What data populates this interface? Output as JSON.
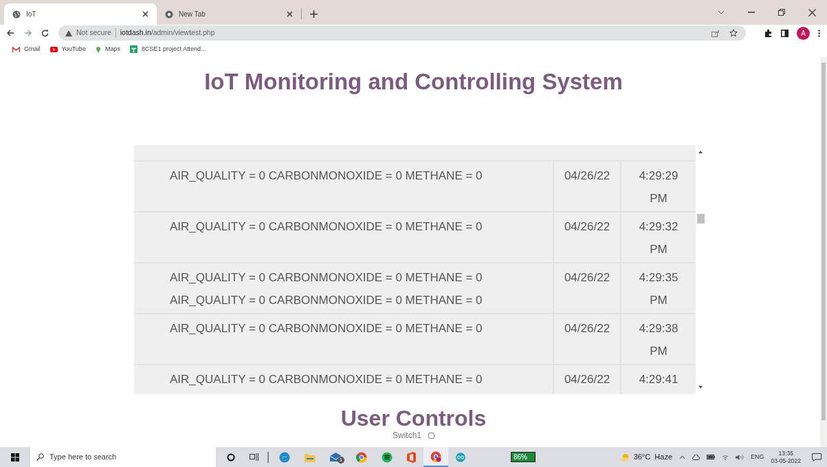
{
  "browser": {
    "tabs": [
      {
        "title": "IoT",
        "selected": true
      },
      {
        "title": "New Tab",
        "selected": false
      }
    ],
    "address": {
      "warning": "Not secure",
      "url_host": "iotdash.in",
      "url_path": "/admin/viewtest.php"
    },
    "profile_initial": "A",
    "bookmarks": [
      {
        "label": "Gmail",
        "kind": "gmail"
      },
      {
        "label": "YouTube",
        "kind": "youtube"
      },
      {
        "label": "Maps",
        "kind": "maps"
      },
      {
        "label": "8CSE1 project Attend...",
        "kind": "sheets"
      }
    ]
  },
  "page": {
    "title": "IoT Monitoring and Controlling System",
    "table": {
      "rows": [
        {
          "reading": "AIR_QUALITY = 0 CARBONMONOXIDE = 0 METHANE = 0",
          "date": "04/26/22",
          "time": "4:29:29 PM"
        },
        {
          "reading": "AIR_QUALITY = 0 CARBONMONOXIDE = 0 METHANE = 0",
          "date": "04/26/22",
          "time": "4:29:32 PM"
        },
        {
          "reading": "AIR_QUALITY = 0 CARBONMONOXIDE = 0 METHANE = 0 AIR_QUALITY = 0 CARBONMONOXIDE = 0 METHANE = 0",
          "date": "04/26/22",
          "time": "4:29:35 PM"
        },
        {
          "reading": "AIR_QUALITY = 0 CARBONMONOXIDE = 0 METHANE = 0",
          "date": "04/26/22",
          "time": "4:29:38 PM"
        },
        {
          "reading": "AIR_QUALITY = 0 CARBONMONOXIDE = 0 METHANE = 0",
          "date": "04/26/22",
          "time": "4:29:41"
        }
      ]
    },
    "controls_title": "User Controls",
    "switches": [
      {
        "label": "Switch1",
        "checked": false
      }
    ]
  },
  "taskbar": {
    "search_placeholder": "Type here to search",
    "mail_badge": "1",
    "battery": "86%",
    "weather": "36°C  Haze",
    "language": "ENG",
    "time": "13:35",
    "date": "03-05-2022"
  }
}
